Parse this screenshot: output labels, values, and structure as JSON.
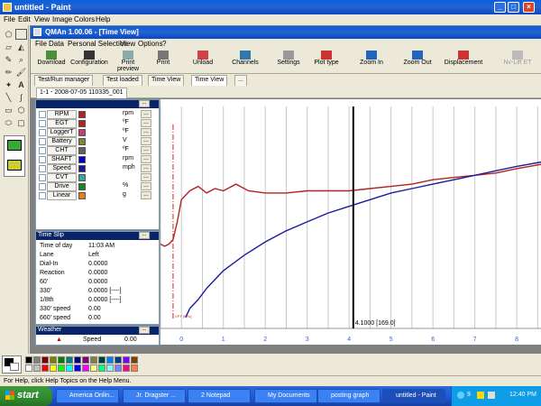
{
  "paint": {
    "title": "untitled - Paint",
    "menu": [
      "File",
      "Edit",
      "View",
      "Image",
      "Colors",
      "Help"
    ],
    "status_text": "For Help, click Help Topics on the Help Menu."
  },
  "qman": {
    "title": "QMAn 1.00.06 - [Time View]",
    "menu": [
      "File",
      "Data",
      "Personal Selection",
      "View",
      "Options",
      "?"
    ],
    "toolbar": [
      {
        "label": "Download",
        "icon": "download-icon"
      },
      {
        "label": "Configuration",
        "icon": "configuration-icon"
      },
      {
        "label": "Print preview",
        "icon": "print-preview-icon"
      },
      {
        "label": "Print",
        "icon": "printer-icon"
      },
      {
        "label": "Unload",
        "icon": "unload-icon"
      },
      {
        "label": "Channels",
        "icon": "channels-icon"
      },
      {
        "label": "Settings",
        "icon": "settings-icon"
      },
      {
        "label": "Plot type",
        "icon": "plot-type-icon"
      },
      {
        "label": "Zoom In",
        "icon": "zoom-in-icon"
      },
      {
        "label": "Zoom Out",
        "icon": "zoom-out-icon"
      },
      {
        "label": "Displacement",
        "icon": "displacement-icon"
      },
      {
        "label": "Nv-Lift ET",
        "icon": "nv-lift-icon"
      }
    ],
    "tabs": [
      "Test/Run manager",
      "Test loaded",
      "Time View",
      "Time View",
      "..."
    ],
    "run_tab": "1-1 - 2008-07-05 110335_001",
    "more_btn": "...",
    "channels": [
      {
        "name": "RPM",
        "unit": "rpm",
        "color": "#b22222",
        "checked": false
      },
      {
        "name": "EGT",
        "unit": "ºF",
        "color": "#b22222",
        "checked": false
      },
      {
        "name": "LoggerT",
        "unit": "ºF",
        "color": "#c04070",
        "checked": false
      },
      {
        "name": "Battery",
        "unit": "V",
        "color": "#808040",
        "checked": false
      },
      {
        "name": "CHT",
        "unit": "ºF",
        "color": "#606060",
        "checked": false
      },
      {
        "name": "SHAFT",
        "unit": "rpm",
        "color": "#0000cc",
        "checked": false
      },
      {
        "name": "Speed",
        "unit": "mph",
        "color": "#1a1a8c",
        "checked": false
      },
      {
        "name": "CVT",
        "unit": "",
        "color": "#40a0a0",
        "checked": false
      },
      {
        "name": "Drive",
        "unit": "%",
        "color": "#208020",
        "checked": false
      },
      {
        "name": "Linear",
        "unit": "g",
        "color": "#e08020",
        "checked": false
      }
    ],
    "timeslip": {
      "title": "Time Slip",
      "rows": [
        {
          "label": "Time of day",
          "value": "11:03 AM"
        },
        {
          "label": "Lane",
          "value": "Left"
        },
        {
          "label": "Dial-In",
          "value": "0.0000"
        },
        {
          "label": "Reaction",
          "value": "0.0000"
        },
        {
          "label": "60'",
          "value": "0.0000"
        },
        {
          "label": "330'",
          "value": "0.0000 [----]"
        },
        {
          "label": "1/8th",
          "value": "0.0000 [----]"
        },
        {
          "label": "330' speed",
          "value": "0.00"
        },
        {
          "label": "660' speed",
          "value": "0.00"
        }
      ]
    },
    "weather": {
      "title": "Weather",
      "label": "Speed",
      "value": "0.00"
    }
  },
  "chart_data": {
    "type": "line",
    "x_ticks": [
      "0",
      "1",
      "2",
      "3",
      "4",
      "5",
      "6",
      "7",
      "8"
    ],
    "xlim": [
      -0.5,
      8.6
    ],
    "cursor_label": "4.1000 [169.0]",
    "cursor_x": 4.1,
    "start_marker_label": "CFT [0.2s]",
    "start_marker_x": -0.2,
    "series": [
      {
        "color": "#b22222",
        "x": [
          -0.5,
          -0.4,
          -0.3,
          -0.2,
          -0.1,
          0.0,
          0.2,
          0.4,
          0.6,
          0.8,
          1.0,
          1.3,
          1.6,
          2.0,
          2.5,
          3.0,
          3.5,
          4.0,
          4.5,
          5.0,
          5.5,
          6.0,
          6.5,
          7.0,
          7.5,
          8.0,
          8.6
        ],
        "y": [
          0.38,
          0.37,
          0.38,
          0.4,
          0.48,
          0.58,
          0.62,
          0.64,
          0.61,
          0.63,
          0.62,
          0.65,
          0.62,
          0.61,
          0.61,
          0.62,
          0.62,
          0.62,
          0.63,
          0.64,
          0.65,
          0.67,
          0.68,
          0.69,
          0.7,
          0.72,
          0.74
        ]
      },
      {
        "color": "#1c1c9c",
        "x": [
          0.1,
          0.2,
          0.4,
          0.6,
          0.8,
          1.0,
          1.5,
          2.0,
          2.5,
          3.0,
          3.5,
          4.0,
          4.5,
          5.0,
          5.5,
          6.0,
          6.5,
          7.0,
          7.5,
          8.0,
          8.6
        ],
        "y": [
          0.05,
          0.09,
          0.13,
          0.18,
          0.22,
          0.26,
          0.33,
          0.39,
          0.44,
          0.48,
          0.52,
          0.55,
          0.58,
          0.61,
          0.63,
          0.65,
          0.67,
          0.69,
          0.71,
          0.73,
          0.75
        ]
      }
    ]
  },
  "palette": [
    "#000000",
    "#808080",
    "#800000",
    "#808000",
    "#008000",
    "#008080",
    "#000080",
    "#800080",
    "#808040",
    "#004040",
    "#0080ff",
    "#004080",
    "#8000ff",
    "#804000",
    "#ffffff",
    "#c0c0c0",
    "#ff0000",
    "#ffff00",
    "#00ff00",
    "#00ffff",
    "#0000ff",
    "#ff00ff",
    "#ffff80",
    "#00ff80",
    "#80ffff",
    "#8080ff",
    "#ff0080",
    "#ff8040"
  ],
  "taskbar": {
    "start": "start",
    "tasks": [
      {
        "label": "America Onlin...",
        "active": false
      },
      {
        "label": "Jr. Dragster ...",
        "active": false
      },
      {
        "label": "2 Notepad",
        "active": false
      },
      {
        "label": "My Documents",
        "active": false
      },
      {
        "label": "posting graph",
        "active": false
      },
      {
        "label": "untitled - Paint",
        "active": true
      }
    ],
    "tray_count": "9",
    "clock": "12:40 PM"
  }
}
